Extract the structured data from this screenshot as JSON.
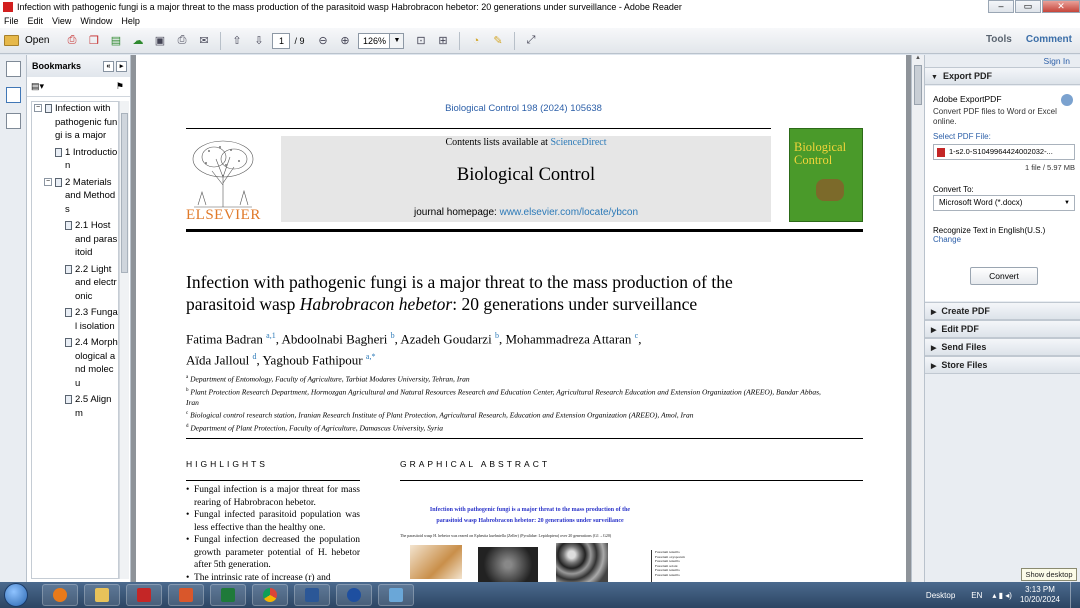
{
  "window": {
    "title": "Infection with pathogenic fungi is a major threat to the mass production of the parasitoid wasp Habrobracon hebetor: 20 generations under surveillance - Adobe Reader",
    "minimize": "–",
    "maximize": "▭",
    "close": "✕"
  },
  "menu": [
    "File",
    "Edit",
    "View",
    "Window",
    "Help"
  ],
  "toolbar": {
    "open_label": "Open",
    "page_current": "1",
    "page_total": "/ 9",
    "zoom": "126%",
    "tools_label": "Tools",
    "comment_label": "Comment"
  },
  "bookmarks": {
    "header": "Bookmarks",
    "items": [
      {
        "label": "Infection with pathogenic fungi is a major",
        "level": 0,
        "expander": "−"
      },
      {
        "label": "1 Introduction",
        "level": 1,
        "expander": ""
      },
      {
        "label": "2 Materials and Methods",
        "level": 1,
        "expander": "−"
      },
      {
        "label": "2.1 Host and parasitoid",
        "level": 2,
        "expander": ""
      },
      {
        "label": "2.2 Light and electronic",
        "level": 2,
        "expander": ""
      },
      {
        "label": "2.3 Fungal isolation",
        "level": 2,
        "expander": ""
      },
      {
        "label": "2.4 Morphological and molecu",
        "level": 2,
        "expander": ""
      },
      {
        "label": "2.5 Alignm",
        "level": 2,
        "expander": ""
      }
    ]
  },
  "document": {
    "journal_citation": "Biological Control 198 (2024) 105638",
    "contents_prefix": "Contents lists available at ",
    "contents_link": "ScienceDirect",
    "journal_title": "Biological Control",
    "homepage_prefix": "journal homepage: ",
    "homepage_link": "www.elsevier.com/locate/ybcon",
    "publisher": "ELSEVIER",
    "cover_title_1": "Biological",
    "cover_title_2": "Control",
    "title_part1": "Infection with pathogenic fungi is a major threat to the mass production of the parasitoid wasp ",
    "title_species": "Habrobracon hebetor",
    "title_part2": ": 20 generations under surveillance",
    "authors_line1": [
      {
        "name": "Fatima Badran",
        "sup": "a,1"
      },
      {
        "name": "Abdoolnabi Bagheri",
        "sup": "b"
      },
      {
        "name": "Azadeh Goudarzi",
        "sup": "b"
      },
      {
        "name": "Mohammadreza Attaran",
        "sup": "c"
      }
    ],
    "authors_line2": [
      {
        "name": "Aïda Jalloul",
        "sup": "d"
      },
      {
        "name": "Yaghoub Fathipour",
        "sup": "a,*"
      }
    ],
    "affiliations": [
      {
        "sup": "a",
        "text": "Department of Entomology, Faculty of Agriculture, Tarbiat Modares University, Tehran, Iran"
      },
      {
        "sup": "b",
        "text": "Plant Protection Research Department, Hormozgan Agricultural and Natural Resources Research and Education Center, Agricultural Research Education and Extension Organization (AREEO), Bandar Abbas, Iran"
      },
      {
        "sup": "c",
        "text": "Biological control research station, Iranian Research Institute of Plant Protection, Agricultural Research, Education and Extension Organization (AREEO), Amol, Iran"
      },
      {
        "sup": "d",
        "text": "Department of Plant Protection, Faculty of Agriculture, Damascus University, Syria"
      }
    ],
    "highlights_heading": "HIGHLIGHTS",
    "graphical_abstract_heading": "GRAPHICAL ABSTRACT",
    "highlights": [
      "Fungal infection is a major threat for mass rearing of Habrobracon hebetor.",
      "Fungal infected parasitoid population was less effective than the healthy one.",
      "Fungal infection decreased the population growth parameter potential of H. hebetor after 5th generation.",
      "The intrinsic rate of increase (r) and"
    ],
    "ga_title_line1": "Infection with pathogenic fungi is a major threat to the mass production of the",
    "ga_title_line2": "parasitoid wasp Habrobracon hebetor: 20 generations under surveillance",
    "ga_caption": "The parasitoid wasp H. hebetor was reared on Ephestia kuehniella (Zeller) (Pyralidae: Lepidoptera) over 20 generations (G1→G20)"
  },
  "right_pane": {
    "sign_in": "Sign In",
    "export_pdf": "Export PDF",
    "export_title": "Adobe ExportPDF",
    "export_desc": "Convert PDF files to Word or Excel online.",
    "select_label": "Select PDF File:",
    "file_name": "1-s2.0-S1049964424002032-...",
    "file_size": "1 file / 5.97 MB",
    "convert_to_label": "Convert To:",
    "convert_to_value": "Microsoft Word (*.docx)",
    "recognize": "Recognize Text in English(U.S.)",
    "change": "Change",
    "convert_button": "Convert",
    "create_pdf": "Create PDF",
    "edit_pdf": "Edit PDF",
    "send_files": "Send Files",
    "store_files": "Store Files"
  },
  "taskbar": {
    "desktop_label": "Desktop",
    "lang": "EN",
    "time": "3:13 PM",
    "date": "10/20/2024",
    "show_desktop_tooltip": "Show desktop"
  },
  "colors": {
    "link": "#2c5fa8",
    "elsevier_orange": "#e07a2a",
    "cover_green": "#4a9a2a"
  }
}
